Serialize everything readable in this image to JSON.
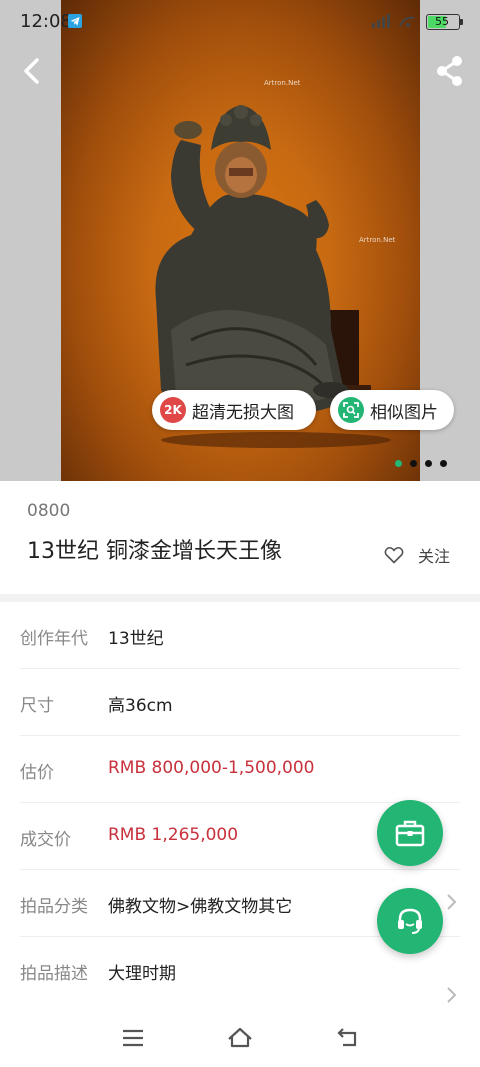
{
  "status_bar": {
    "time": "12:08",
    "battery": "55",
    "battery_level": 0.55
  },
  "hero": {
    "watermark": "Artron.Net",
    "hd_badge": "2K",
    "hd_label": "超清无损大图",
    "similar_label": "相似图片",
    "page_count": 4,
    "current_page": 1
  },
  "item": {
    "lot_number": "0800",
    "title": "13世纪 铜漆金增长天王像",
    "follow_label": "关注"
  },
  "details": [
    {
      "label": "创作年代",
      "value": "13世纪",
      "highlight": false
    },
    {
      "label": "尺寸",
      "value": "高36cm",
      "highlight": false
    },
    {
      "label": "估价",
      "value": "RMB  800,000-1,500,000",
      "highlight": true
    },
    {
      "label": "成交价",
      "value": "RMB 1,265,000",
      "highlight": true
    },
    {
      "label": "拍品分类",
      "value": "佛教文物>佛教文物其它",
      "highlight": false
    },
    {
      "label": "拍品描述",
      "value": "大理时期",
      "highlight": false
    }
  ],
  "colors": {
    "accent": "#22b573",
    "price": "#c8313c",
    "hd_badge": "#e04848"
  },
  "icons": [
    "back-arrow-icon",
    "share-icon",
    "telegram-icon",
    "heart-icon",
    "briefcase-icon",
    "headset-icon",
    "chevron-right-icon",
    "menu-icon",
    "home-icon",
    "return-icon"
  ]
}
